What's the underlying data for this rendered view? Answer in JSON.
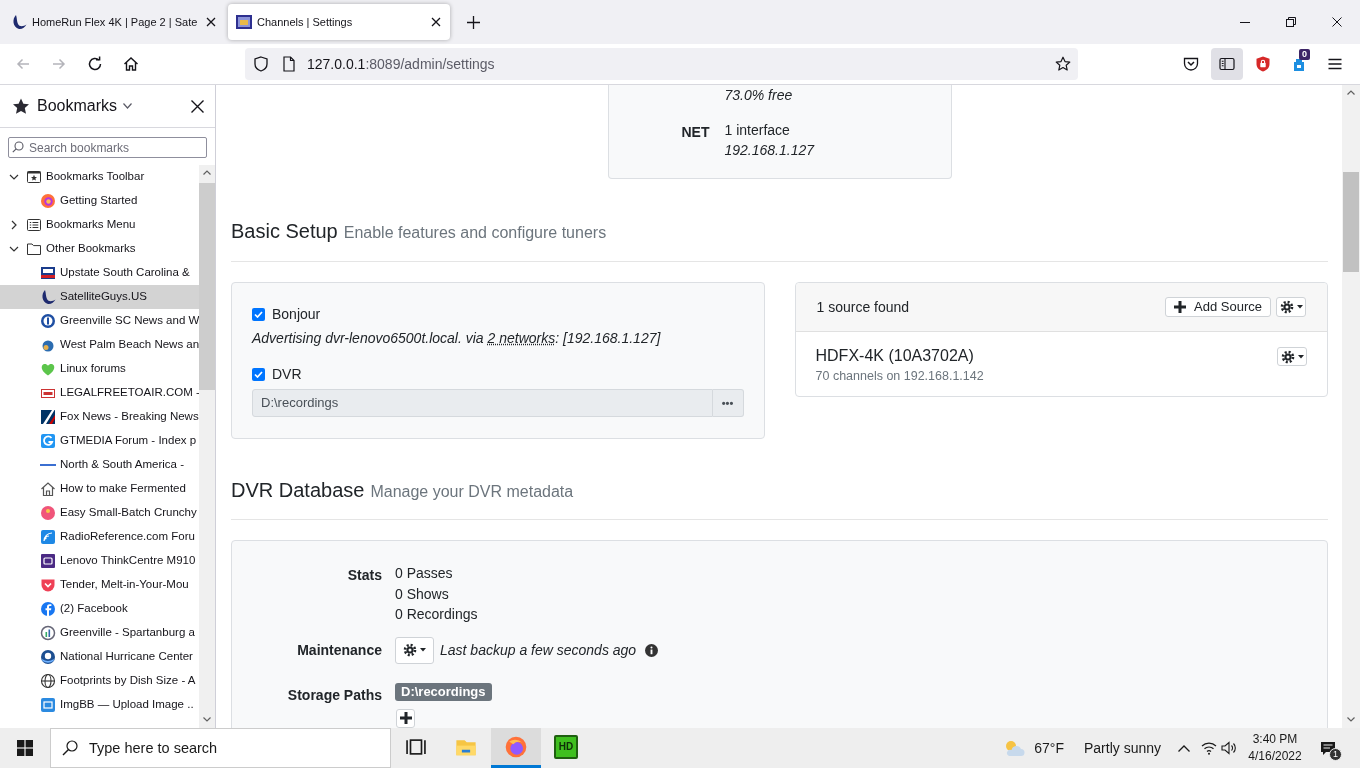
{
  "browser": {
    "tabs": [
      {
        "title": "HomeRun Flex 4K | Page 2 | Sate",
        "selected": false
      },
      {
        "title": "Channels | Settings",
        "selected": true
      }
    ],
    "nav_buttons": [
      {
        "kind": "back",
        "disabled": true
      },
      {
        "kind": "forward",
        "disabled": true
      },
      {
        "kind": "reload",
        "disabled": false
      },
      {
        "kind": "home",
        "disabled": false
      }
    ],
    "address": {
      "host": "127.0.0.1",
      "path": ":8089/admin/settings"
    },
    "toolbar": [
      {
        "kind": "pocket",
        "pressed": false
      },
      {
        "kind": "sidebar",
        "pressed": true
      },
      {
        "kind": "shield",
        "pressed": false
      },
      {
        "kind": "extension",
        "pressed": false,
        "badge": "0"
      },
      {
        "kind": "menu",
        "pressed": false
      }
    ]
  },
  "sidebar": {
    "title": "Bookmarks",
    "search": {
      "placeholder": "Search bookmarks"
    },
    "items": [
      {
        "label": "Bookmarks Toolbar",
        "kind": "toolbar_folder",
        "expanded": true,
        "selected": false,
        "children": [
          {
            "label": "Getting Started",
            "selected": false
          }
        ]
      },
      {
        "label": "Bookmarks Menu",
        "kind": "menu_folder",
        "expanded": false,
        "selected": false
      },
      {
        "label": "Other Bookmarks",
        "kind": "folder",
        "expanded": true,
        "selected": false,
        "children": [
          {
            "label": "Upstate South Carolina &",
            "selected": false
          },
          {
            "label": "SatelliteGuys.US",
            "selected": true
          },
          {
            "label": "Greenville SC News and W",
            "selected": false
          },
          {
            "label": "West Palm Beach News an",
            "selected": false
          },
          {
            "label": "Linux forums",
            "selected": false
          },
          {
            "label": "LEGALFREETOAIR.COM -",
            "selected": false
          },
          {
            "label": "Fox News - Breaking News",
            "selected": false
          },
          {
            "label": "GTMEDIA Forum - Index p",
            "selected": false
          },
          {
            "label": "North & South America -",
            "selected": false
          },
          {
            "label": "How to make Fermented",
            "selected": false
          },
          {
            "label": "Easy Small-Batch Crunchy",
            "selected": false
          },
          {
            "label": "RadioReference.com Foru",
            "selected": false
          },
          {
            "label": "Lenovo ThinkCentre M910",
            "selected": false
          },
          {
            "label": "Tender, Melt-in-Your-Mou",
            "selected": false
          },
          {
            "label": "(2) Facebook",
            "selected": false
          },
          {
            "label": "Greenville - Spartanburg a",
            "selected": false
          },
          {
            "label": "National Hurricane Center",
            "selected": false
          },
          {
            "label": "Footprints by Dish Size - A",
            "selected": false
          },
          {
            "label": "ImgBB — Upload Image ..",
            "selected": false
          }
        ]
      }
    ]
  },
  "system_info": {
    "groups": [
      {
        "lines": [
          {
            "text": "73.0% free",
            "kind": "detail"
          }
        ]
      },
      {
        "label": "NET",
        "lines": [
          {
            "text": "1 interface",
            "kind": "summary"
          },
          {
            "text": "192.168.1.127",
            "kind": "detail"
          }
        ]
      }
    ]
  },
  "basic_setup": {
    "title": "Basic Setup",
    "subtitle": "Enable features and configure tuners",
    "options": [
      {
        "label": "Bonjour",
        "checked": true,
        "kind": "note",
        "note": {
          "before": "Advertising dvr-lenovo6500t.local. via ",
          "link": "2 networks",
          "after": ": [192.168.1.127]"
        }
      },
      {
        "label": "DVR",
        "checked": true,
        "kind": "path",
        "path": "D:\\recordings",
        "browse_label": "•••"
      }
    ],
    "sources": {
      "summary": "1 source found",
      "add_button": "Add Source",
      "devices": [
        {
          "name": "HDFX-4K (10A3702A)",
          "detail": "70 channels on 192.168.1.142"
        }
      ]
    }
  },
  "dvr_database": {
    "title": "DVR Database",
    "subtitle": "Manage your DVR metadata",
    "stats": {
      "label": "Stats",
      "values": [
        "0 Passes",
        "0 Shows",
        "0 Recordings"
      ]
    },
    "maintenance": {
      "label": "Maintenance",
      "note": "Last backup a few seconds ago"
    },
    "storage": {
      "label": "Storage Paths",
      "paths": [
        "D:\\recordings"
      ]
    }
  },
  "taskbar": {
    "search": {
      "placeholder": "Type here to search"
    },
    "apps": [
      {
        "kind": "task_view",
        "active": false
      },
      {
        "kind": "explorer",
        "active": false
      },
      {
        "kind": "browser",
        "active": true
      },
      {
        "kind": "hd",
        "label": "HD",
        "active": false
      }
    ],
    "weather": {
      "temperature": "67°F",
      "condition": "Partly sunny"
    },
    "time": "3:40 PM",
    "date": "4/16/2022",
    "notification_count": "1"
  }
}
